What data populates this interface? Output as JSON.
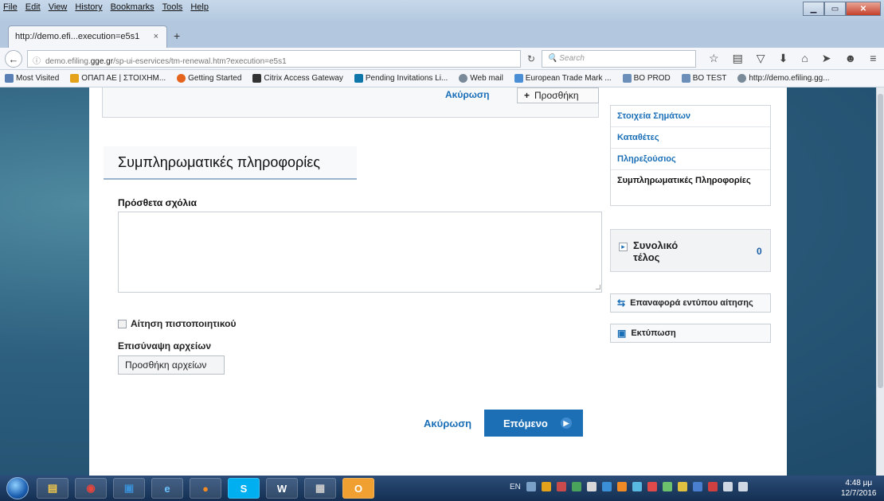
{
  "browser": {
    "menu": [
      "File",
      "Edit",
      "View",
      "History",
      "Bookmarks",
      "Tools",
      "Help"
    ],
    "tab_title": "http://demo.efi...execution=e5s1",
    "url_prefix": "demo.efiling.",
    "url_domain": "gge.gr",
    "url_rest": "/sp-ui-eservices/tm-renewal.htm?execution=e5s1",
    "search_placeholder": "Search",
    "bookmarks": [
      {
        "label": "Most Visited",
        "color": "#5a7fb5"
      },
      {
        "label": "ΟΠΑΠ ΑΕ | ΣΤΟΙΧΗΜ...",
        "color": "#e3a21a"
      },
      {
        "label": "Getting Started",
        "color": "#e5641d"
      },
      {
        "label": "Citrix Access Gateway",
        "color": "#333333"
      },
      {
        "label": "Pending Invitations Li...",
        "color": "#0e76a8"
      },
      {
        "label": "Web mail",
        "color": "#7a8a99"
      },
      {
        "label": "European Trade Mark ...",
        "color": "#4a8fd6"
      },
      {
        "label": "BO PROD",
        "color": "#6b8fb8"
      },
      {
        "label": "BO TEST",
        "color": "#6b8fb8"
      },
      {
        "label": "http://demo.efiling.gg...",
        "color": "#7a8a99"
      }
    ]
  },
  "page": {
    "top_cancel": "Ακύρωση",
    "top_add": "Προσθήκη",
    "section_title": "Συμπληρωματικές πληροφορίες",
    "notes_label": "Πρόσθετα σχόλια",
    "certificate_label": "Αίτηση πιστοποιητικού",
    "attach_label": "Επισύναψη αρχείων",
    "add_files": "Προσθήκη αρχείων",
    "cancel": "Ακύρωση",
    "next": "Επόμενο"
  },
  "sidebar": {
    "items": [
      "Στοιχεία Σημάτων",
      "Καταθέτες",
      "Πληρεξούσιος",
      "Συμπληρωματικές Πληροφορίες"
    ],
    "total_label": "Συνολικό τέλος",
    "total_value": "0",
    "reset_label": "Επαναφορά εντύπου αίτησης",
    "print_label": "Εκτύπωση"
  },
  "taskbar": {
    "lang": "EN",
    "time": "4:48 μμ",
    "date": "12/7/2016"
  },
  "colors": {
    "link": "#1a6fb7",
    "primary_button": "#1c6fb5"
  }
}
